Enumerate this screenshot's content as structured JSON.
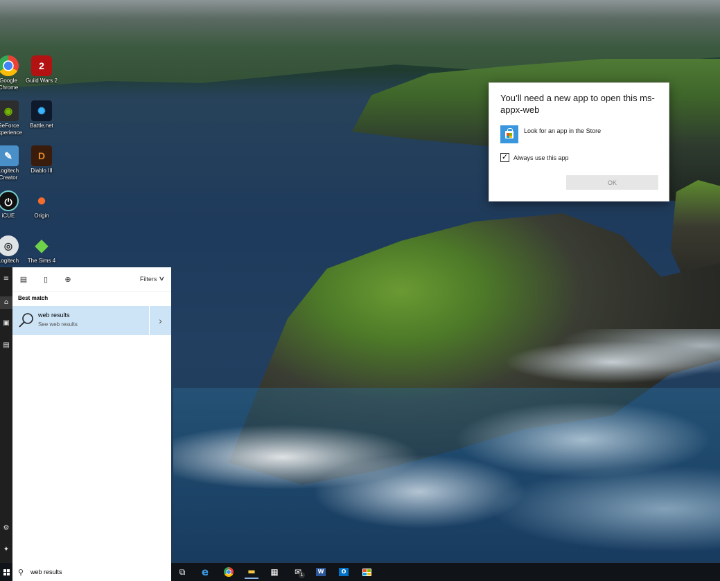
{
  "desktop": {
    "icons": [
      {
        "label": "Google Chrome",
        "icon": "chrome-icon"
      },
      {
        "label": "Guild Wars 2",
        "icon": "guild-wars-2-icon"
      },
      {
        "label": "GeForce Experience",
        "icon": "geforce-icon"
      },
      {
        "label": "Battle.net",
        "icon": "battlenet-icon"
      },
      {
        "label": "Logitech Creator",
        "icon": "logitech-creator-icon"
      },
      {
        "label": "Diablo III",
        "icon": "diablo-icon"
      },
      {
        "label": "iCUE",
        "icon": "icue-icon"
      },
      {
        "label": "Origin",
        "icon": "origin-icon"
      },
      {
        "label": "Logitech",
        "icon": "logitech-icon"
      },
      {
        "label": "The Sims 4",
        "icon": "sims-icon"
      }
    ]
  },
  "dialog": {
    "title": "You’ll need a new app to open this ms-appx-web",
    "store_option": "Look for an app in the Store",
    "always_label": "Always use this app",
    "always_checked": "✓",
    "ok_label": "OK"
  },
  "search_panel": {
    "filters_label": "Filters",
    "best_match_label": "Best match",
    "result": {
      "title": "web results",
      "subtitle": "See web results"
    }
  },
  "taskbar": {
    "search_value": "web results",
    "items": [
      "task-view-icon",
      "edge-icon",
      "chrome-icon",
      "file-explorer-icon",
      "calculator-icon",
      "mail-icon",
      "word-icon",
      "outlook-icon",
      "store-icon"
    ],
    "mail_badge": "1"
  },
  "colors": {
    "accent": "#3a96dd",
    "selection": "#cde4f7",
    "taskbar": "#101418"
  }
}
